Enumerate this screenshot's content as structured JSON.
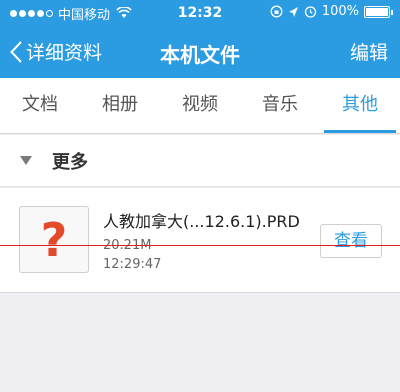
{
  "status_bar": {
    "carrier": "中国移动",
    "time": "12:32",
    "battery": "100%",
    "battery_level": 1.0
  },
  "nav": {
    "back_label": "详细资料",
    "title": "本机文件",
    "edit_label": "编辑"
  },
  "tabs": [
    {
      "label": "文档"
    },
    {
      "label": "相册"
    },
    {
      "label": "视频"
    },
    {
      "label": "音乐"
    },
    {
      "label": "其他"
    }
  ],
  "section": {
    "title": "更多"
  },
  "file": {
    "icon_glyph": "?",
    "name": "人教加拿大(...12.6.1).PRD",
    "size": "20.21M",
    "time": "12:29:47",
    "view_label": "查看"
  },
  "colors": {
    "accent": "#2b9be2",
    "unknown_file": "#e24a2b"
  }
}
